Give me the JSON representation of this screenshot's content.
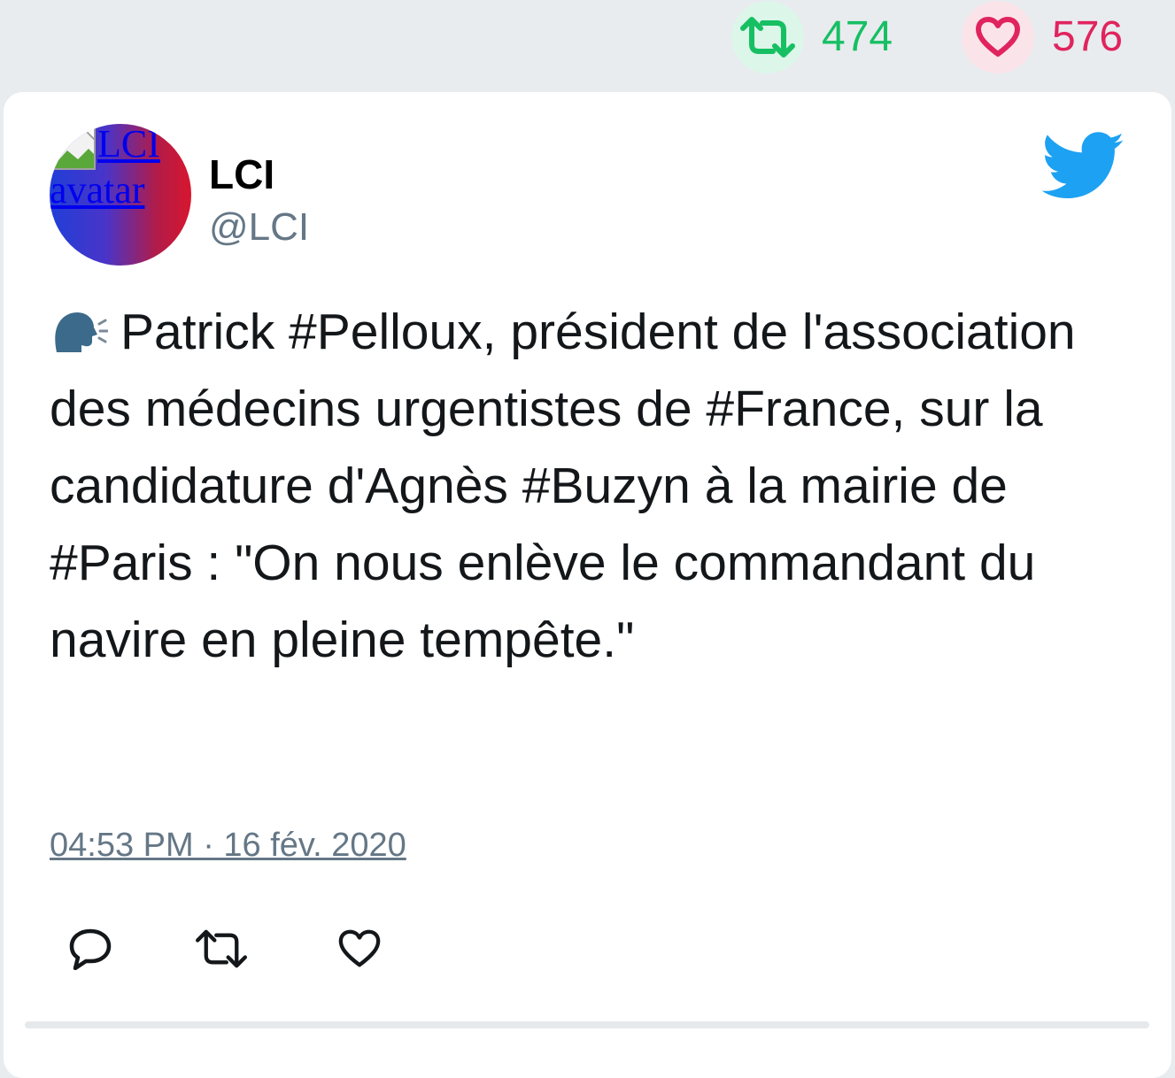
{
  "stats": {
    "retweet_count": "474",
    "like_count": "576",
    "retweet_icon": "retweet-icon",
    "like_icon": "heart-icon",
    "retweet_color": "#17bf63",
    "like_color": "#e0245e"
  },
  "tweet": {
    "author": {
      "name": "LCI",
      "handle": "@LCI",
      "avatar_alt": "LCI avatar"
    },
    "text": "Patrick #Pelloux, président de l'association des médecins urgentistes de #France, sur la candidature d'Agnès #Buzyn à la mairie de #Paris : \"On nous enlève le commandant du navire en pleine tempête.\"",
    "text_emoji": "speaking-head-emoji",
    "timestamp": "04:53 PM · 16 fév. 2020",
    "brand_icon": "twitter-bird-icon",
    "brand_color": "#1da1f2"
  },
  "actions": {
    "reply_icon": "reply-icon",
    "retweet_icon": "retweet-icon",
    "like_icon": "heart-icon"
  }
}
